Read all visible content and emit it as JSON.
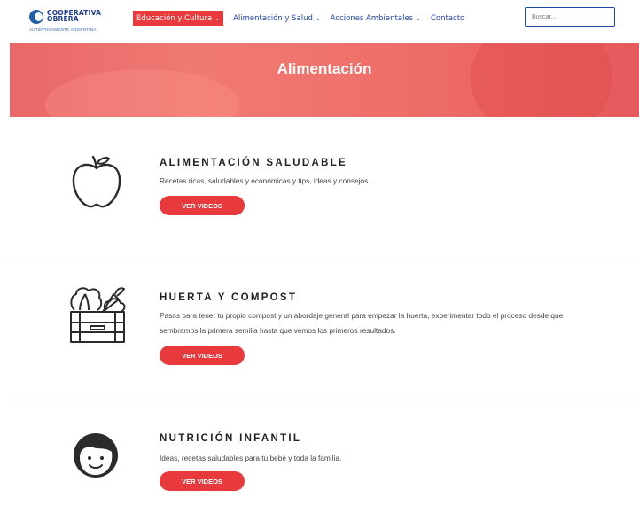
{
  "header": {
    "logo_line1": "COOPERATIVA",
    "logo_line2": "OBRERA",
    "logo_tagline": "AUTÉNTICAMENTE ARGENTINA",
    "nav": [
      {
        "label": "Educación y Cultura",
        "active": true
      },
      {
        "label": "Alimentación y Salud",
        "active": false
      },
      {
        "label": "Acciones Ambientales",
        "active": false
      },
      {
        "label": "Contacto",
        "active": false
      }
    ],
    "search_placeholder": "Buscar..."
  },
  "banner": {
    "title": "Alimentación"
  },
  "sections": [
    {
      "icon": "apple-icon",
      "title": "ALIMENTACIÓN SALUDABLE",
      "description": "Recetas ricas, saludables y económicas y tips, ideas y consejos.",
      "button": "VER VIDEOS"
    },
    {
      "icon": "vegetable-crate-icon",
      "title": "HUERTA Y COMPOST",
      "description": "Pasos para tener tu propio compost y un abordaje general para empezar la huerta, experimentar todo el proceso desde que sembramos la primera semilla hasta que vemos los primeros resultados.",
      "button": "VER VIDEOS"
    },
    {
      "icon": "child-face-icon",
      "title": "NUTRICIÓN INFANTIL",
      "description": "Ideas, recetas saludables para tu bebé y toda la familia.",
      "button": "VER VIDEOS"
    }
  ],
  "colors": {
    "accent": "#e8393c",
    "nav": "#1f47a8",
    "icon_stroke": "#2b2b2b"
  }
}
